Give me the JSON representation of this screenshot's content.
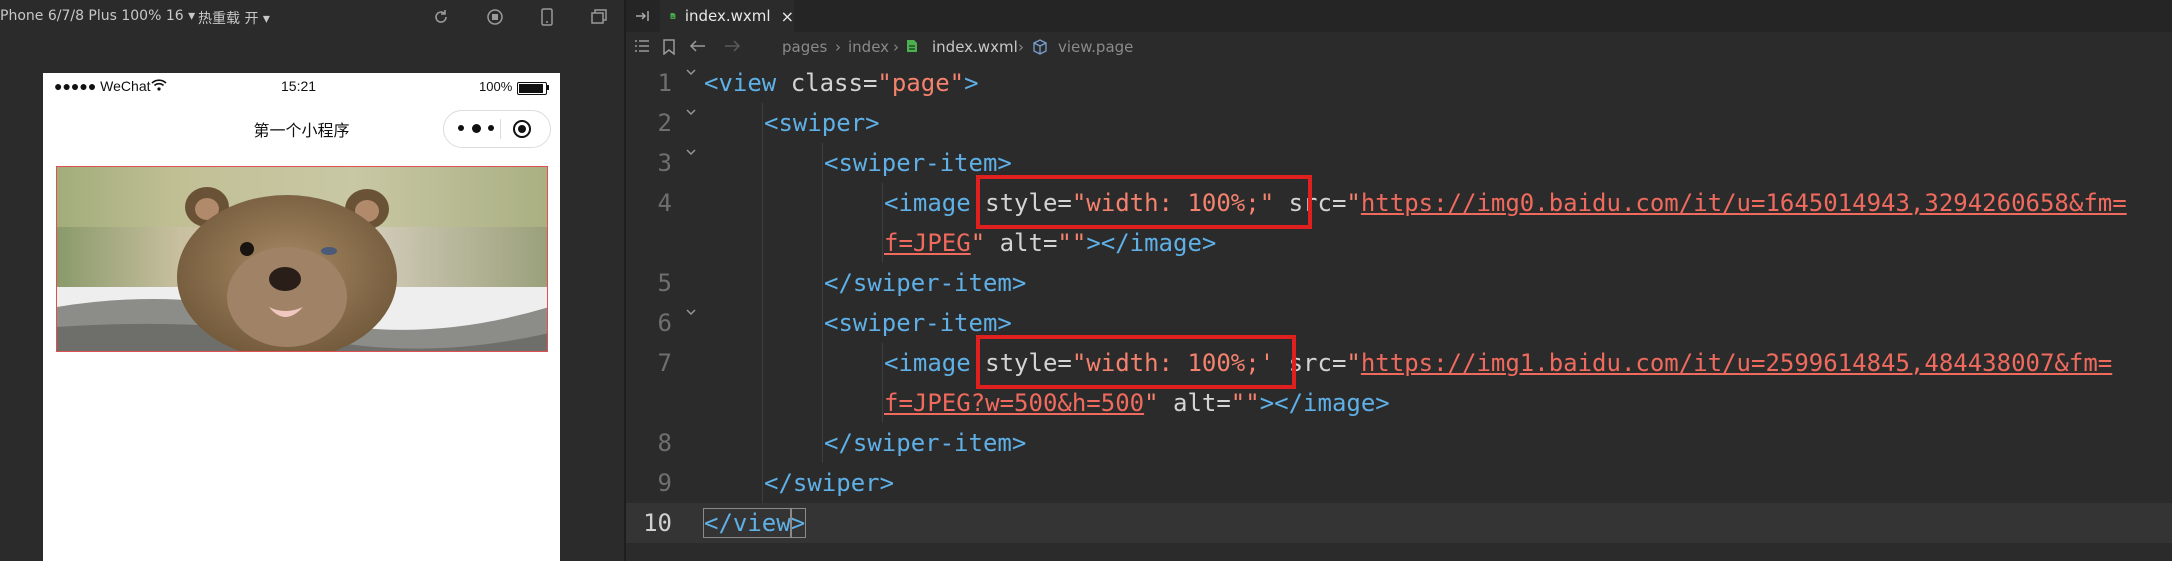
{
  "simulator": {
    "device_label": "Phone 6/7/8 Plus 100% 16 ▾",
    "hot_reload_label": "热重载 开 ▾",
    "status": {
      "carrier": "●●●●● WeChat",
      "time": "15:21",
      "battery": "100%"
    },
    "nav_title": "第一个小程序"
  },
  "editor": {
    "tab": {
      "name": "index.wxml",
      "close": "×"
    },
    "breadcrumb": [
      "pages",
      "index",
      "index.wxml",
      "view.page"
    ],
    "lines": [
      {
        "n": "1",
        "parts": [
          "<view",
          " class=",
          "\"page\"",
          ">"
        ]
      },
      {
        "n": "2",
        "parts": [
          "<swiper>"
        ]
      },
      {
        "n": "3",
        "parts": [
          "<swiper-item>"
        ]
      },
      {
        "n": "4",
        "parts": [
          "<image",
          " style=",
          "\"width: 100%;\"",
          " src=",
          "\"",
          "https://img0.baidu.com/it/u=1645014943,3294260658&fm="
        ]
      },
      {
        "n": "",
        "parts": [
          "f=JPEG",
          "\"",
          " alt=",
          "\"\"",
          "></image>"
        ]
      },
      {
        "n": "5",
        "parts": [
          "</swiper-item>"
        ]
      },
      {
        "n": "6",
        "parts": [
          "<swiper-item>"
        ]
      },
      {
        "n": "7",
        "parts": [
          "<image",
          " style=",
          "\"width: 100%;'",
          " src=",
          "\"",
          "https://img1.baidu.com/it/u=2599614845,484438007&fm="
        ]
      },
      {
        "n": "",
        "parts": [
          "f=JPEG?w=500&h=500",
          "\"",
          " alt=",
          "\"\"",
          "></image>"
        ]
      },
      {
        "n": "8",
        "parts": [
          "</swiper-item>"
        ]
      },
      {
        "n": "9",
        "parts": [
          "</swiper>"
        ]
      },
      {
        "n": "10",
        "parts": [
          "</view",
          ">"
        ]
      }
    ]
  },
  "colors": {
    "tag": "#5fb0e6",
    "string": "#f5826e",
    "link": "#f06a5e",
    "highlight": "#e0201e",
    "background": "#2b2b2b"
  },
  "icons": [
    "refresh-icon",
    "stop-icon",
    "phone-icon",
    "window-icon",
    "list-icon",
    "bookmark-icon",
    "back-arrow-icon",
    "forward-arrow-icon",
    "wxml-file-icon",
    "cube-icon"
  ]
}
